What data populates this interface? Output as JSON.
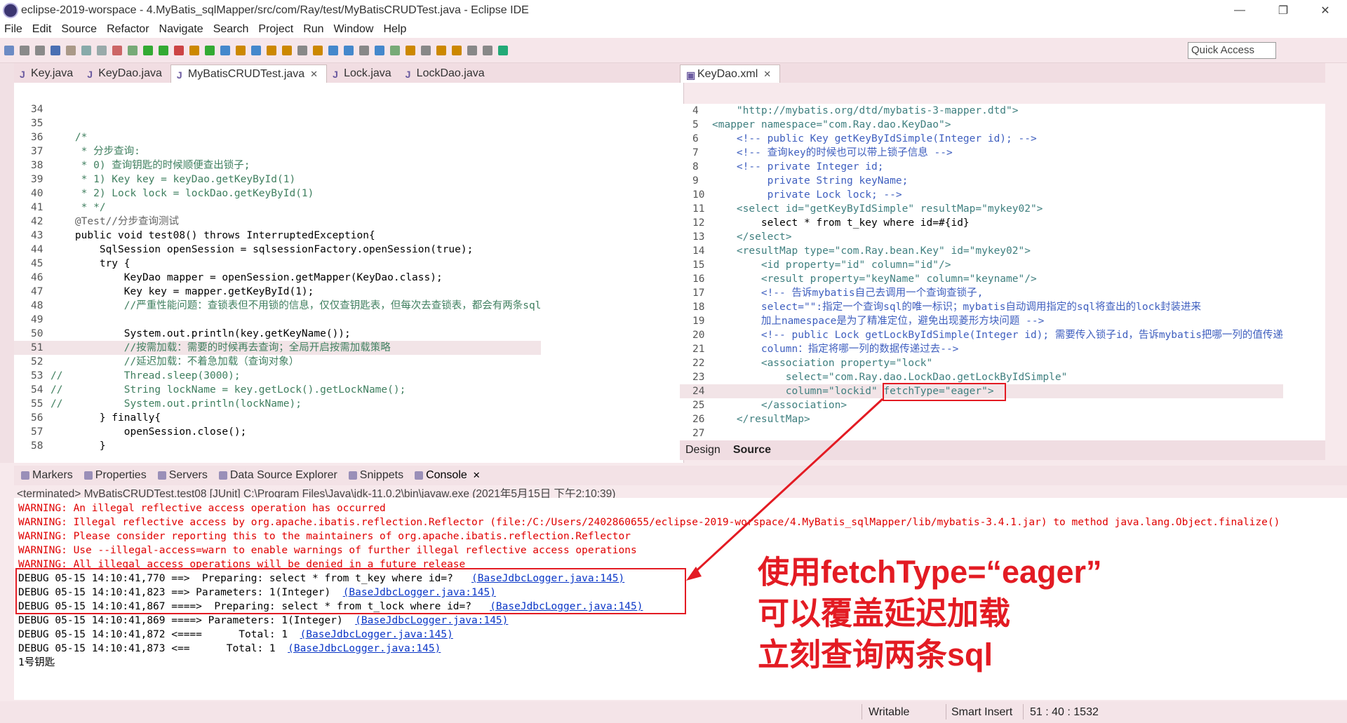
{
  "window": {
    "title": "eclipse-2019-worspace - 4.MyBatis_sqlMapper/src/com/Ray/test/MyBatisCRUDTest.java - Eclipse IDE",
    "minimize": "—",
    "maximize": "❐",
    "close": "✕"
  },
  "menu": [
    "File",
    "Edit",
    "Source",
    "Refactor",
    "Navigate",
    "Search",
    "Project",
    "Run",
    "Window",
    "Help"
  ],
  "quick_access": "Quick Access",
  "java_tabs": [
    {
      "label": "Key.java",
      "active": false
    },
    {
      "label": "KeyDao.java",
      "active": false
    },
    {
      "label": "MyBatisCRUDTest.java",
      "active": true
    },
    {
      "label": "Lock.java",
      "active": false
    },
    {
      "label": "LockDao.java",
      "active": false
    }
  ],
  "java_lines": [
    {
      "n": "34",
      "t": ""
    },
    {
      "n": "35",
      "t": ""
    },
    {
      "n": "36",
      "t": "    /*"
    },
    {
      "n": "37",
      "t": "     * 分步查询:"
    },
    {
      "n": "38",
      "t": "     * 0) 查询钥匙的时候顺便查出锁子;"
    },
    {
      "n": "39",
      "t": "     * 1) Key key = keyDao.getKeyById(1)"
    },
    {
      "n": "40",
      "t": "     * 2) Lock lock = lockDao.getKeyById(1)"
    },
    {
      "n": "41",
      "t": "     * */"
    },
    {
      "n": "42",
      "t": "    @Test//分步查询测试"
    },
    {
      "n": "43",
      "t": "    public void test08() throws InterruptedException{"
    },
    {
      "n": "44",
      "t": "        SqlSession openSession = sqlsessionFactory.openSession(true);"
    },
    {
      "n": "45",
      "t": "        try {"
    },
    {
      "n": "46",
      "t": "            KeyDao mapper = openSession.getMapper(KeyDao.class);"
    },
    {
      "n": "47",
      "t": "            Key key = mapper.getKeyById(1);"
    },
    {
      "n": "48",
      "t": "            //严重性能问题：查锁表但不用锁的信息，仅仅查钥匙表，但每次去查锁表，都会有两条sql"
    },
    {
      "n": "49",
      "t": ""
    },
    {
      "n": "50",
      "t": "            System.out.println(key.getKeyName());"
    },
    {
      "n": "51",
      "t": "            //按需加载：需要的时候再去查询；全局开启按需加载策略"
    },
    {
      "n": "52",
      "t": "            //延迟加载：不着急加载（查询对象）"
    },
    {
      "n": "53",
      "t": "//          Thread.sleep(3000);"
    },
    {
      "n": "54",
      "t": "//          String lockName = key.getLock().getLockName();"
    },
    {
      "n": "55",
      "t": "//          System.out.println(lockName);"
    },
    {
      "n": "56",
      "t": "        } finally{"
    },
    {
      "n": "57",
      "t": "            openSession.close();"
    },
    {
      "n": "58",
      "t": "        }"
    }
  ],
  "xml_tab": "KeyDao.xml",
  "xml_lines": [
    {
      "n": "4",
      "t": "    \"http://mybatis.org/dtd/mybatis-3-mapper.dtd\">"
    },
    {
      "n": "5",
      "t": "<mapper namespace=\"com.Ray.dao.KeyDao\">"
    },
    {
      "n": "6",
      "t": "    <!-- public Key getKeyByIdSimple(Integer id); -->"
    },
    {
      "n": "7",
      "t": "    <!-- 查询key的时候也可以带上锁子信息 -->"
    },
    {
      "n": "8",
      "t": "    <!-- private Integer id;"
    },
    {
      "n": "9",
      "t": "         private String keyName;"
    },
    {
      "n": "10",
      "t": "         private Lock lock; -->"
    },
    {
      "n": "11",
      "t": "    <select id=\"getKeyByIdSimple\" resultMap=\"mykey02\">"
    },
    {
      "n": "12",
      "t": "        select * from t_key where id=#{id}"
    },
    {
      "n": "13",
      "t": "    </select>"
    },
    {
      "n": "14",
      "t": "    <resultMap type=\"com.Ray.bean.Key\" id=\"mykey02\">"
    },
    {
      "n": "15",
      "t": "        <id property=\"id\" column=\"id\"/>"
    },
    {
      "n": "16",
      "t": "        <result property=\"keyName\" column=\"keyname\"/>"
    },
    {
      "n": "17",
      "t": "        <!-- 告诉mybatis自己去调用一个查询查锁子,"
    },
    {
      "n": "18",
      "t": "        select=\"\":指定一个查询sql的唯一标识；mybatis自动调用指定的sql将查出的lock封装进来"
    },
    {
      "n": "19",
      "t": "        加上namespace是为了精准定位，避免出现菱形方块问题 -->"
    },
    {
      "n": "20",
      "t": "        <!-- public Lock getLockByIdSimple(Integer id); 需要传入锁子id，告诉mybatis把哪一列的值传递"
    },
    {
      "n": "21",
      "t": "        column：指定将哪一列的数据传递过去-->"
    },
    {
      "n": "22",
      "t": "        <association property=\"lock\""
    },
    {
      "n": "23",
      "t": "            select=\"com.Ray.dao.LockDao.getLockByIdSimple\""
    },
    {
      "n": "24",
      "t": "            column=\"lockid\" fetchType=\"eager\">"
    },
    {
      "n": "25",
      "t": "        </association>"
    },
    {
      "n": "26",
      "t": "    </resultMap>"
    },
    {
      "n": "27",
      "t": ""
    }
  ],
  "design_tabs": [
    "Design",
    "Source"
  ],
  "console_tabs": [
    "Markers",
    "Properties",
    "Servers",
    "Data Source Explorer",
    "Snippets",
    "Console"
  ],
  "terminated": "<terminated> MyBatisCRUDTest.test08 [JUnit] C:\\Program Files\\Java\\jdk-11.0.2\\bin\\javaw.exe (2021年5月15日 下午2:10:39)",
  "console_lines": [
    {
      "type": "warn",
      "text": "WARNING: An illegal reflective access operation has occurred",
      "link": ""
    },
    {
      "type": "warn",
      "text": "WARNING: Illegal reflective access by org.apache.ibatis.reflection.Reflector (file:/C:/Users/2402860655/eclipse-2019-worspace/4.MyBatis_sqlMapper/lib/mybatis-3.4.1.jar) to method java.lang.Object.finalize()",
      "link": ""
    },
    {
      "type": "warn",
      "text": "WARNING: Please consider reporting this to the maintainers of org.apache.ibatis.reflection.Reflector",
      "link": ""
    },
    {
      "type": "warn",
      "text": "WARNING: Use --illegal-access=warn to enable warnings of further illegal reflective access operations",
      "link": ""
    },
    {
      "type": "warn",
      "text": "WARNING: All illegal access operations will be denied in a future release",
      "link": ""
    },
    {
      "type": "dbg",
      "text": "DEBUG 05-15 14:10:41,770 ==>  Preparing: select * from t_key where id=?   ",
      "link": "(BaseJdbcLogger.java:145)"
    },
    {
      "type": "dbg",
      "text": "DEBUG 05-15 14:10:41,823 ==> Parameters: 1(Integer)  ",
      "link": "(BaseJdbcLogger.java:145)"
    },
    {
      "type": "dbg",
      "text": "DEBUG 05-15 14:10:41,867 ====>  Preparing: select * from t_lock where id=?   ",
      "link": "(BaseJdbcLogger.java:145)"
    },
    {
      "type": "dbg",
      "text": "DEBUG 05-15 14:10:41,869 ====> Parameters: 1(Integer)  ",
      "link": "(BaseJdbcLogger.java:145)"
    },
    {
      "type": "dbg",
      "text": "DEBUG 05-15 14:10:41,872 <====      Total: 1  ",
      "link": "(BaseJdbcLogger.java:145)"
    },
    {
      "type": "dbg",
      "text": "DEBUG 05-15 14:10:41,873 <==      Total: 1  ",
      "link": "(BaseJdbcLogger.java:145)"
    },
    {
      "type": "dbg",
      "text": "1号钥匙",
      "link": ""
    }
  ],
  "annotation": {
    "line1": "使用fetchType=“eager”",
    "line2": "可以覆盖延迟加载",
    "line3": "立刻查询两条sql",
    "color": "#e31b23"
  },
  "status": {
    "writable": "Writable",
    "insert_mode": "Smart Insert",
    "position": "51 : 40 : 1532"
  }
}
